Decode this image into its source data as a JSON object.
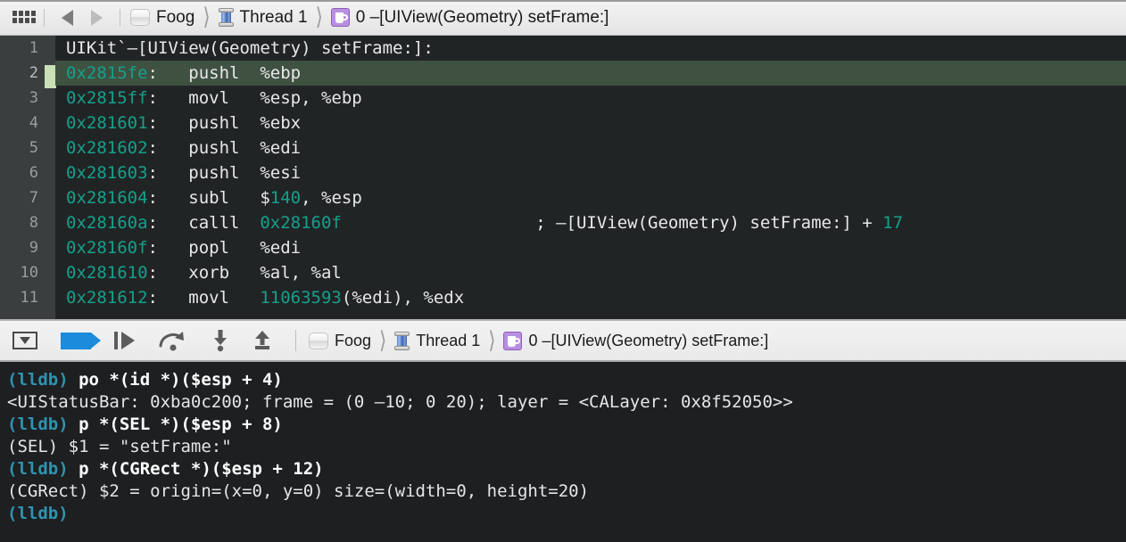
{
  "jumpbar": {
    "related_items_icon": "grid-icon",
    "back_label": "Back",
    "forward_label": "Forward",
    "breadcrumbs": [
      {
        "icon": "project-icon",
        "label": "Foog"
      },
      {
        "icon": "thread-spool-icon",
        "label": "Thread 1"
      },
      {
        "icon": "stack-frame-icon",
        "label": "0 –[UIView(Geometry) setFrame:]"
      }
    ]
  },
  "code": {
    "lines": [
      {
        "num": "1",
        "current": false,
        "segments": [
          {
            "t": "plain",
            "v": "UIKit`–[UIView(Geometry) setFrame:]:"
          }
        ]
      },
      {
        "num": "2",
        "current": true,
        "segments": [
          {
            "t": "addr",
            "v": "0x2815fe"
          },
          {
            "t": "plain",
            "v": ":   pushl  %ebp"
          }
        ]
      },
      {
        "num": "3",
        "current": false,
        "segments": [
          {
            "t": "addr",
            "v": "0x2815ff"
          },
          {
            "t": "plain",
            "v": ":   movl   %esp, %ebp"
          }
        ]
      },
      {
        "num": "4",
        "current": false,
        "segments": [
          {
            "t": "addr",
            "v": "0x281601"
          },
          {
            "t": "plain",
            "v": ":   pushl  %ebx"
          }
        ]
      },
      {
        "num": "5",
        "current": false,
        "segments": [
          {
            "t": "addr",
            "v": "0x281602"
          },
          {
            "t": "plain",
            "v": ":   pushl  %edi"
          }
        ]
      },
      {
        "num": "6",
        "current": false,
        "segments": [
          {
            "t": "addr",
            "v": "0x281603"
          },
          {
            "t": "plain",
            "v": ":   pushl  %esi"
          }
        ]
      },
      {
        "num": "7",
        "current": false,
        "segments": [
          {
            "t": "addr",
            "v": "0x281604"
          },
          {
            "t": "plain",
            "v": ":   subl   $"
          },
          {
            "t": "num",
            "v": "140"
          },
          {
            "t": "plain",
            "v": ", %esp"
          }
        ]
      },
      {
        "num": "8",
        "current": false,
        "segments": [
          {
            "t": "addr",
            "v": "0x28160a"
          },
          {
            "t": "plain",
            "v": ":   calll  "
          },
          {
            "t": "addr",
            "v": "0x28160f"
          },
          {
            "t": "plain",
            "v": "                   ; –[UIView(Geometry) setFrame:] + "
          },
          {
            "t": "num",
            "v": "17"
          }
        ]
      },
      {
        "num": "9",
        "current": false,
        "segments": [
          {
            "t": "addr",
            "v": "0x28160f"
          },
          {
            "t": "plain",
            "v": ":   popl   %edi"
          }
        ]
      },
      {
        "num": "10",
        "current": false,
        "segments": [
          {
            "t": "addr",
            "v": "0x281610"
          },
          {
            "t": "plain",
            "v": ":   xorb   %al, %al"
          }
        ]
      },
      {
        "num": "11",
        "current": false,
        "segments": [
          {
            "t": "addr",
            "v": "0x281612"
          },
          {
            "t": "plain",
            "v": ":   movl   "
          },
          {
            "t": "num",
            "v": "11063593"
          },
          {
            "t": "plain",
            "v": "(%edi), %edx"
          }
        ]
      }
    ],
    "pc_indicator": "program-counter-arrow"
  },
  "debugbar": {
    "buttons": [
      {
        "icon": "hide-debug-area-icon",
        "label": "Hide Debug Area"
      },
      {
        "icon": "continue-icon",
        "label": "Continue program execution"
      },
      {
        "icon": "step-over-icon",
        "label": "Step over"
      },
      {
        "icon": "step-into-icon",
        "label": "Step into"
      },
      {
        "icon": "step-down-icon",
        "label": "Step in instruction"
      },
      {
        "icon": "step-out-icon",
        "label": "Step out"
      }
    ],
    "breadcrumbs": [
      {
        "icon": "project-icon",
        "label": "Foog"
      },
      {
        "icon": "thread-spool-icon",
        "label": "Thread 1"
      },
      {
        "icon": "stack-frame-icon",
        "label": "0 –[UIView(Geometry) setFrame:]"
      }
    ]
  },
  "console": {
    "lines": [
      {
        "kind": "command",
        "prompt": "(lldb)",
        "text": " po *(id *)($esp + 4)"
      },
      {
        "kind": "output",
        "prompt": "",
        "text": "<UIStatusBar: 0xba0c200; frame = (0 –10; 0 20); layer = <CALayer: 0x8f52050>>"
      },
      {
        "kind": "command",
        "prompt": "(lldb)",
        "text": " p *(SEL *)($esp + 8)"
      },
      {
        "kind": "output",
        "prompt": "",
        "text": "(SEL) $1 = \"setFrame:\""
      },
      {
        "kind": "command",
        "prompt": "(lldb)",
        "text": " p *(CGRect *)($esp + 12)"
      },
      {
        "kind": "output",
        "prompt": "",
        "text": "(CGRect) $2 = origin=(x=0, y=0) size=(width=0, height=20)"
      },
      {
        "kind": "command",
        "prompt": "(lldb)",
        "text": ""
      }
    ]
  },
  "colors": {
    "code_bg": "#212425",
    "gutter_bg": "#3b3e3f",
    "current_line_bg": "#3f5141",
    "address_teal": "#15a08a",
    "prompt_cyan": "#2f93b0",
    "continue_blue": "#1a8cdb",
    "frame_purple": "#b98fe0"
  }
}
